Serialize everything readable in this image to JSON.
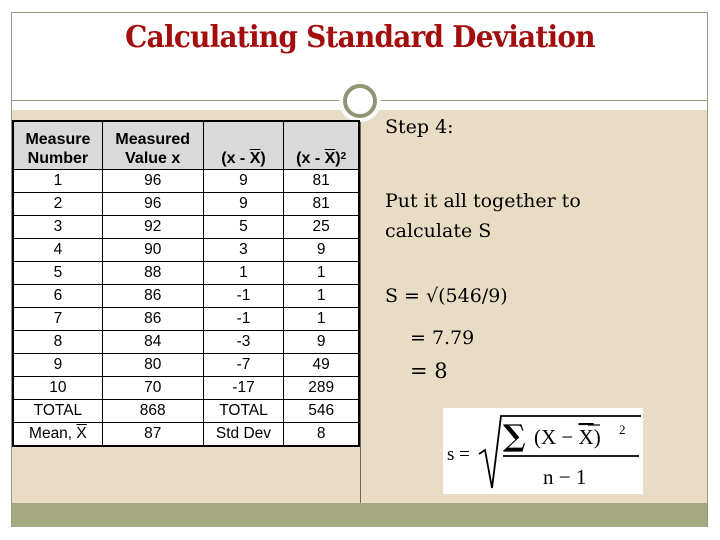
{
  "slide": {
    "title": "Calculating Standard Deviation",
    "colors": {
      "title": "#a30d0d",
      "content_bg": "#e8dcc4",
      "footer": "#a4a982",
      "ornament": "#8f9472",
      "table_header_bg": "#d9d9d9"
    }
  },
  "table": {
    "headers": {
      "col1_line1": "Measure",
      "col1_line2": "Number",
      "col2_line1": "Measured",
      "col2_line2": "Value x",
      "col3_prefix": "(x - ",
      "col3_bar": "X",
      "col3_suffix": ")",
      "col4_prefix": "(x - ",
      "col4_bar": "X",
      "col4_suffix": ")",
      "col4_sup": "2"
    },
    "rows": [
      [
        "1",
        "96",
        "9",
        "81"
      ],
      [
        "2",
        "96",
        "9",
        "81"
      ],
      [
        "3",
        "92",
        "5",
        "25"
      ],
      [
        "4",
        "90",
        "3",
        "9"
      ],
      [
        "5",
        "88",
        "1",
        "1"
      ],
      [
        "6",
        "86",
        "-1",
        "1"
      ],
      [
        "7",
        "86",
        "-1",
        "1"
      ],
      [
        "8",
        "84",
        "-3",
        "9"
      ],
      [
        "9",
        "80",
        "-7",
        "49"
      ],
      [
        "10",
        "70",
        "-17",
        "289"
      ]
    ],
    "total_row": [
      "TOTAL",
      "868",
      "TOTAL",
      "546"
    ],
    "mean_row": {
      "label_prefix": "Mean, ",
      "label_bar": "X",
      "mean": "87",
      "stddev_label": "Std Dev",
      "stddev": "8"
    }
  },
  "right_panel": {
    "step": "Step 4:",
    "instruction": "Put it all together to calculate S",
    "equation_line1": "S = √(546/9)",
    "equation_line2": "= 7.79",
    "equation_line3": "= 8"
  },
  "formula": {
    "lhs": "s =",
    "numerator": "∑(X − X̄)²",
    "sigma": "∑",
    "num_text_a": "(X − ",
    "num_bar": "X",
    "num_text_b": ")",
    "num_sup": "2",
    "denominator": "n − 1"
  }
}
